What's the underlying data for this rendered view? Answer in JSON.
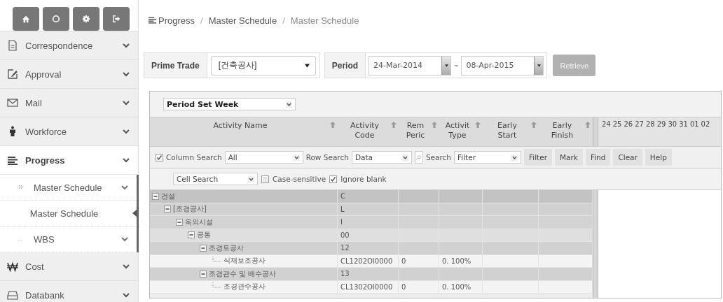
{
  "breadcrumb": [
    {
      "kind": "link",
      "label": "Progress"
    },
    {
      "kind": "separator",
      "label": "/"
    },
    {
      "kind": "link",
      "label": "Master Schedule"
    },
    {
      "kind": "separator",
      "label": "/"
    },
    {
      "kind": "current",
      "label": "Master Schedule"
    }
  ],
  "sidebar": {
    "items": [
      {
        "label": "Correspondence",
        "expanded": false
      },
      {
        "label": "Approval",
        "expanded": false
      },
      {
        "label": "Mail",
        "expanded": false
      },
      {
        "label": "Workforce",
        "expanded": false
      },
      {
        "label": "Progress",
        "expanded": true,
        "children": [
          {
            "label": "Master Schedule",
            "expanded": true,
            "children": [
              {
                "label": "Master Schedule",
                "selected": true
              }
            ]
          },
          {
            "label": "WBS",
            "expanded": false
          }
        ]
      },
      {
        "label": "Cost",
        "expanded": false
      },
      {
        "label": "Databank",
        "expanded": false
      }
    ]
  },
  "filters": {
    "prime_trade": {
      "label": "Prime Trade",
      "value": "[건축공사]"
    },
    "period": {
      "label": "Period",
      "from": "24-Mar-2014",
      "separator": "~",
      "to": "08-Apr-2015"
    },
    "retrieve": "Retrieve"
  },
  "grid": {
    "period_set": "Period Set Week",
    "columns": [
      {
        "label": "Activity Name"
      },
      {
        "label": "Activity\nCode"
      },
      {
        "label": "Rem\nPeric"
      },
      {
        "label": "Activit\nType"
      },
      {
        "label": "Early\nStart"
      },
      {
        "label": "Early\nFinish"
      }
    ],
    "timeline_days": [
      "24",
      "25",
      "26",
      "27",
      "28",
      "29",
      "30",
      "31",
      "01",
      "02"
    ],
    "search_bar": {
      "column_search_enabled": true,
      "column_search_label": "Column Search",
      "column_search_value": "All",
      "row_search_label": "Row Search",
      "row_search_value": "Data",
      "search_label": "Search",
      "filter_value": "Filter",
      "buttons": [
        "Filter",
        "Mark",
        "Find",
        "Clear",
        "Help"
      ],
      "cell_search_value": "Cell Search",
      "case_sensitive": {
        "label": "Case-sensitive",
        "checked": false
      },
      "ignore_blank": {
        "label": "Ignore blank",
        "checked": true
      }
    },
    "rows": [
      {
        "name": "건설",
        "code": "C",
        "expanded": true,
        "children": [
          {
            "name": "[조경공사]",
            "code": "L",
            "expanded": true,
            "children": [
              {
                "name": "옥외시설",
                "code": "I",
                "expanded": true,
                "children": [
                  {
                    "name": "공통",
                    "code": "00",
                    "expanded": true,
                    "children": [
                      {
                        "name": "조경토공사",
                        "code": "12",
                        "expanded": true,
                        "children": [
                          {
                            "name": "식재보조공사",
                            "code": "CL1202OI0000",
                            "rem_period": "0",
                            "activity_type": "0. 100%"
                          }
                        ]
                      },
                      {
                        "name": "조경관수 및 배수공사",
                        "code": "13",
                        "expanded": true,
                        "children": [
                          {
                            "name": "조경관수공사",
                            "code": "CL1302OI0000",
                            "rem_period": "0",
                            "activity_type": "0. 100%"
                          }
                        ]
                      }
                    ]
                  }
                ]
              }
            ]
          }
        ]
      }
    ]
  }
}
